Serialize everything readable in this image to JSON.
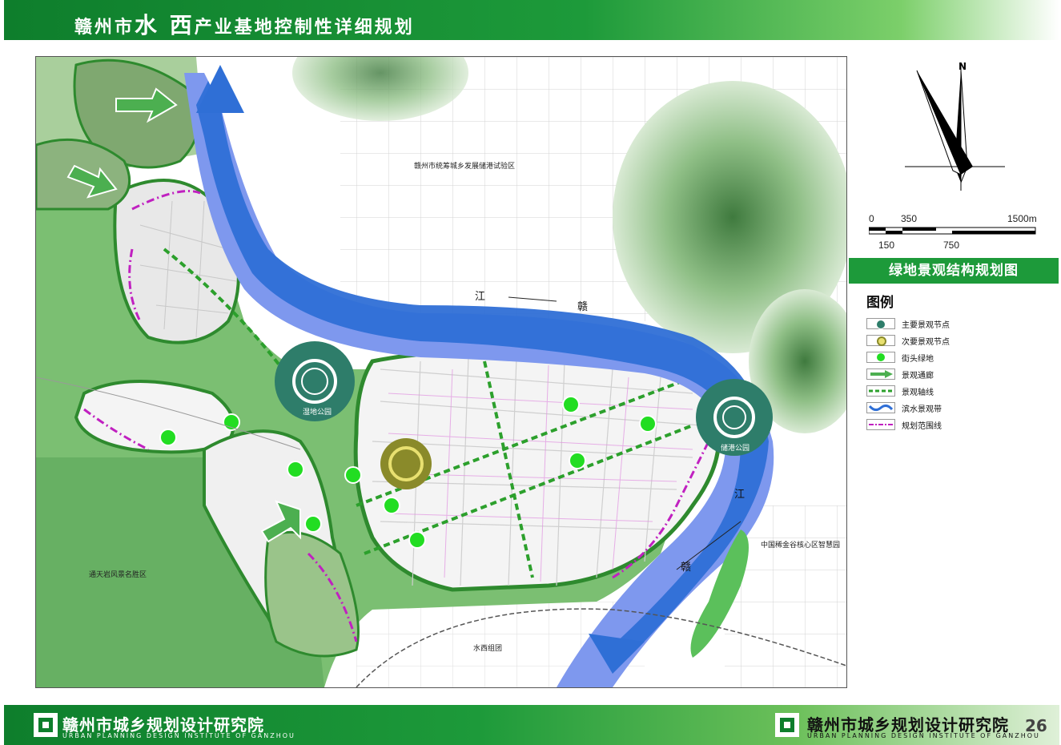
{
  "header": {
    "title_prefix": "赣州市",
    "title_big": "水 西",
    "title_suffix": "产业基地控制性详细规划"
  },
  "map": {
    "labels": {
      "zone_north": "赣州市统筹城乡发展储港试验区",
      "wetland_park": "湿地公园",
      "port_park": "储港公园",
      "tongtianyan": "通天岩风景名胜区",
      "shuixi_group": "水西组团",
      "rare_earth": "中国稀金谷核心区智慧园",
      "river_jiang_1": "江",
      "river_gan_1": "赣",
      "river_jiang_2": "江",
      "river_gan_2": "赣"
    }
  },
  "compass": {
    "north": "N"
  },
  "scale": {
    "t0": "0",
    "t350": "350",
    "t1500": "1500m",
    "t150": "150",
    "t750": "750"
  },
  "panel": {
    "title": "绿地景观结构规划图",
    "legend_title": "图例",
    "legend": [
      {
        "label": "主要景观节点",
        "icon": "major-node-icon"
      },
      {
        "label": "次要景观节点",
        "icon": "minor-node-icon"
      },
      {
        "label": "街头绿地",
        "icon": "street-green-icon"
      },
      {
        "label": "景观通廊",
        "icon": "corridor-arrow-icon"
      },
      {
        "label": "景观轴线",
        "icon": "axis-line-icon"
      },
      {
        "label": "滨水景观带",
        "icon": "waterfront-icon"
      },
      {
        "label": "规划范围线",
        "icon": "boundary-line-icon"
      }
    ]
  },
  "footer": {
    "name_cn": "赣州市城乡规划设计研究院",
    "name_en": "URBAN PLANNING DESIGN INSTITUTE OF GANZHOU",
    "name_cn_right": "赣州市城乡规划设计研究院",
    "name_en_right": "URBAN PLANNING DESIGN INSTITUTE OF GANZHOU",
    "page": "26"
  },
  "colors": {
    "header_green": "#1d9a3a",
    "river_blue": "#2f6fd6",
    "river_light": "#7e98ee",
    "park_green": "#4fae55",
    "street_green": "#22dd22",
    "boundary_magenta": "#c020c0",
    "hill_green": "#7fb07a"
  }
}
